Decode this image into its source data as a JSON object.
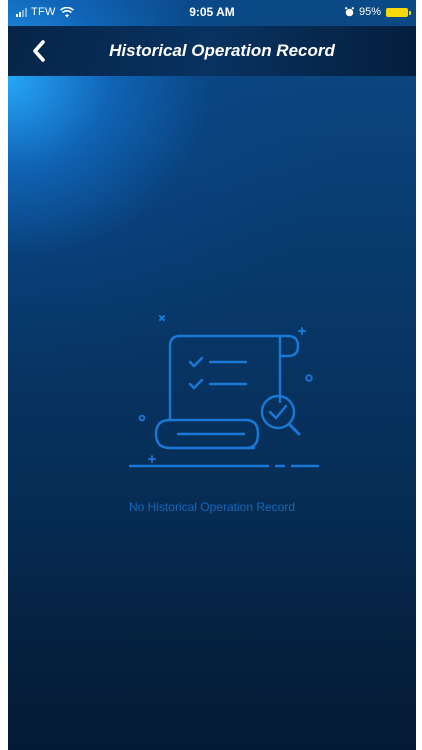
{
  "status_bar": {
    "carrier": "TFW",
    "time": "9:05 AM",
    "battery_percent": "95%",
    "battery_level": 0.95,
    "battery_color": "#f5d90a"
  },
  "nav": {
    "back_icon": "chevron-left-icon",
    "title": "Historical Operation Record"
  },
  "empty_state": {
    "icon": "document-scroll-search-icon",
    "message": "No Historical Operation Record",
    "accent_color": "#1a78d6"
  },
  "colors": {
    "background_top": "#0b4a86",
    "background_bottom": "#051e3b",
    "glow": "#28aaff"
  }
}
